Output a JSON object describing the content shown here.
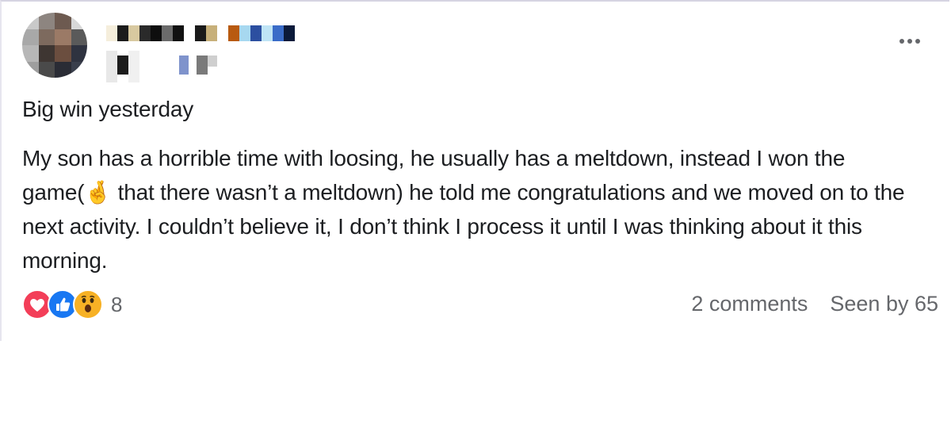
{
  "post": {
    "title": "Big win yesterday",
    "body_part1": "My son has a horrible time with loosing, he usually has a meltdown, instead I won the game(",
    "body_emoji": "🤞",
    "body_part2": " that there wasn’t a meltdown) he told me congratulations and we moved on to the next activity. I couldn’t believe it, I don’t think I process it until I was thinking about it this morning."
  },
  "reactions": {
    "icons": [
      "love-icon",
      "like-icon",
      "wow-icon"
    ],
    "count": "8"
  },
  "footer": {
    "comments": "2 comments",
    "seen_by": "Seen by 65"
  },
  "colors": {
    "love": "#f33e58",
    "like": "#1877f2",
    "wow": "#f7b125",
    "secondary_text": "#65676b"
  }
}
